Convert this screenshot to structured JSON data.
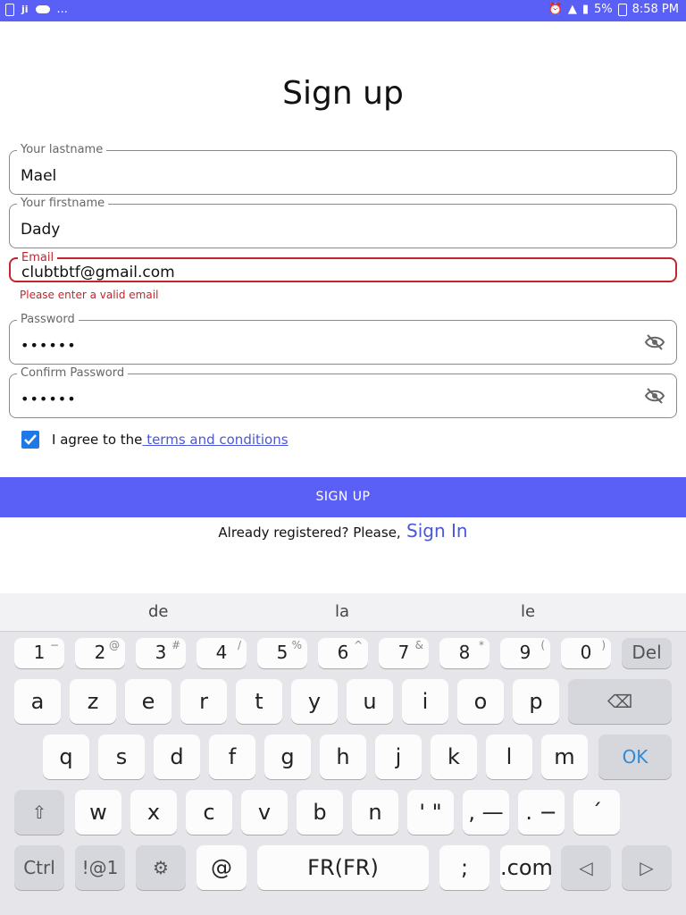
{
  "status_bar": {
    "left_text": "...",
    "right_text": "5%",
    "time": "8:58 PM"
  },
  "form": {
    "title": "Sign up",
    "lastname": {
      "label": "Your lastname",
      "value": "Mael"
    },
    "firstname": {
      "label": "Your firstname",
      "value": "Dady"
    },
    "email": {
      "label": "Email",
      "value": "clubtbtf@gmail.com",
      "error": "Please enter a valid email"
    },
    "password": {
      "label": "Password",
      "value": "••••••"
    },
    "confirm": {
      "label": "Confirm Password",
      "value": "••••••"
    },
    "agree_text": "I agree to the",
    "terms_link": " terms and conditions",
    "signup_button": "SIGN UP",
    "already_text": "Already registered? Please,",
    "signin_link": " Sign In"
  },
  "keyboard": {
    "suggestions": [
      "de",
      "la",
      "le"
    ],
    "row1": [
      {
        "k": "1",
        "s": "−"
      },
      {
        "k": "2",
        "s": "@"
      },
      {
        "k": "3",
        "s": "#"
      },
      {
        "k": "4",
        "s": "/"
      },
      {
        "k": "5",
        "s": "%"
      },
      {
        "k": "6",
        "s": "^"
      },
      {
        "k": "7",
        "s": "&"
      },
      {
        "k": "8",
        "s": "*"
      },
      {
        "k": "9",
        "s": "("
      },
      {
        "k": "0",
        "s": ")"
      }
    ],
    "del": "Del",
    "row2": [
      "a",
      "z",
      "e",
      "r",
      "t",
      "y",
      "u",
      "i",
      "o",
      "p"
    ],
    "row3": [
      "q",
      "s",
      "d",
      "f",
      "g",
      "h",
      "j",
      "k",
      "l",
      "m"
    ],
    "ok": "OK",
    "row4": [
      "w",
      "x",
      "c",
      "v",
      "b",
      "n"
    ],
    "row4_extra": [
      "' \"",
      ", —",
      ". −",
      "´"
    ],
    "ctrl": "Ctrl",
    "sym": "!@1",
    "at": "@",
    "space": "FR(FR)",
    "semicolon": ";",
    "dotcom": ".com",
    "colors": {
      "accent": "#5a5ff6",
      "link": "#4a57d8",
      "error": "#c0262d",
      "checkbox": "#1e78e6"
    }
  }
}
